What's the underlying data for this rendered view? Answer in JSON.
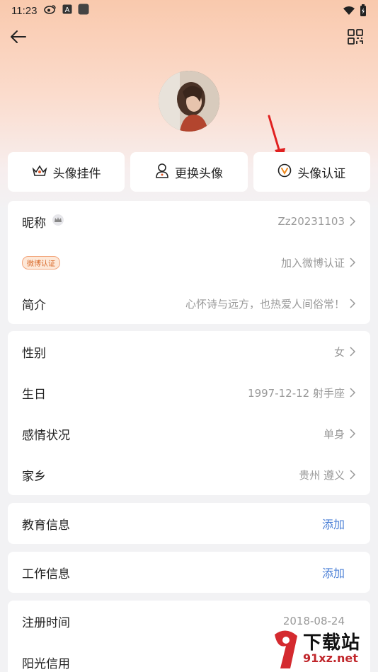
{
  "status_bar": {
    "time": "11:23"
  },
  "actions": [
    {
      "label": "头像挂件",
      "icon": "crown-frame-icon"
    },
    {
      "label": "更换头像",
      "icon": "person-swap-icon"
    },
    {
      "label": "头像认证",
      "icon": "verified-v-icon"
    }
  ],
  "profile": {
    "nickname_label": "昵称",
    "nickname_value": "Zz20231103",
    "weibo_badge": "微博认证",
    "weibo_value": "加入微博认证",
    "intro_label": "简介",
    "intro_value": "心怀诗与远方，也热爱人间俗常！"
  },
  "basic": {
    "gender_label": "性别",
    "gender_value": "女",
    "birthday_label": "生日",
    "birthday_value": "1997-12-12 射手座",
    "relation_label": "感情状况",
    "relation_value": "单身",
    "hometown_label": "家乡",
    "hometown_value": "贵州 遵义"
  },
  "education": {
    "label": "教育信息",
    "action": "添加"
  },
  "work": {
    "label": "工作信息",
    "action": "添加"
  },
  "account": {
    "register_label": "注册时间",
    "register_value": "2018-08-24",
    "credit_label": "阳光信用"
  },
  "watermark": {
    "text": "下载站",
    "url": "91xz.net"
  },
  "colors": {
    "accent_link": "#4a7fd6",
    "arrow": "#e02020"
  }
}
